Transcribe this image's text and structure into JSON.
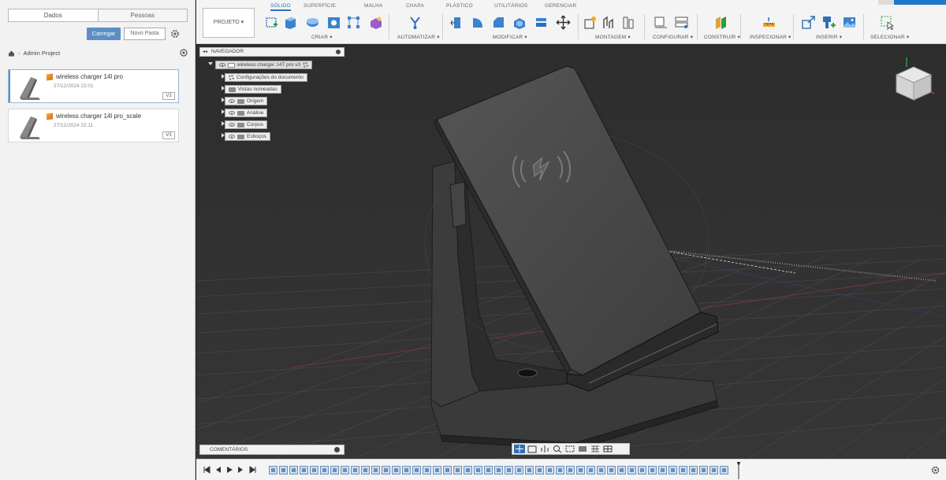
{
  "data_panel": {
    "tabs": [
      "Dados",
      "Pessoas"
    ],
    "upload_label": "Carregar",
    "new_folder_label": "Novo Pasta",
    "breadcrumb": "Admin Project",
    "files": [
      {
        "name": "wireless charger 14l pro",
        "date": "27/12/2024 22:01",
        "version": "V3"
      },
      {
        "name": "wireless charger 14l pro_scale",
        "date": "27/12/2024 22:11",
        "version": "V3"
      }
    ]
  },
  "toolbar": {
    "project_label": "PROJETO ▾",
    "tabs": [
      "SÓLIDO",
      "SUPERFÍCIE",
      "MALHA",
      "CHAPA",
      "PLÁSTICO",
      "UTILITÁRIOS",
      "GERENCIAR"
    ],
    "groups": [
      "CRIAR ▾",
      "AUTOMATIZAR ▾",
      "MODIFICAR ▾",
      "MONTAGEM ▾",
      "CONFIGURAR ▾",
      "CONSTRUIR ▾",
      "INSPECIONAR ▾",
      "INSERIR ▾",
      "SELECIONAR ▾"
    ]
  },
  "browser": {
    "title": "NAVEGADOR",
    "root": "wireless charger 14T pro v3",
    "items": [
      "Configurações do documento",
      "Vistas nomeadas",
      "Origem",
      "Análise",
      "Corpos",
      "Esboços"
    ]
  },
  "comments_label": "COMENTÁRIOS",
  "colors": {
    "accent": "#2f6fb8",
    "upload": "#5c8ec7",
    "viewport": "#2e2e2e"
  }
}
